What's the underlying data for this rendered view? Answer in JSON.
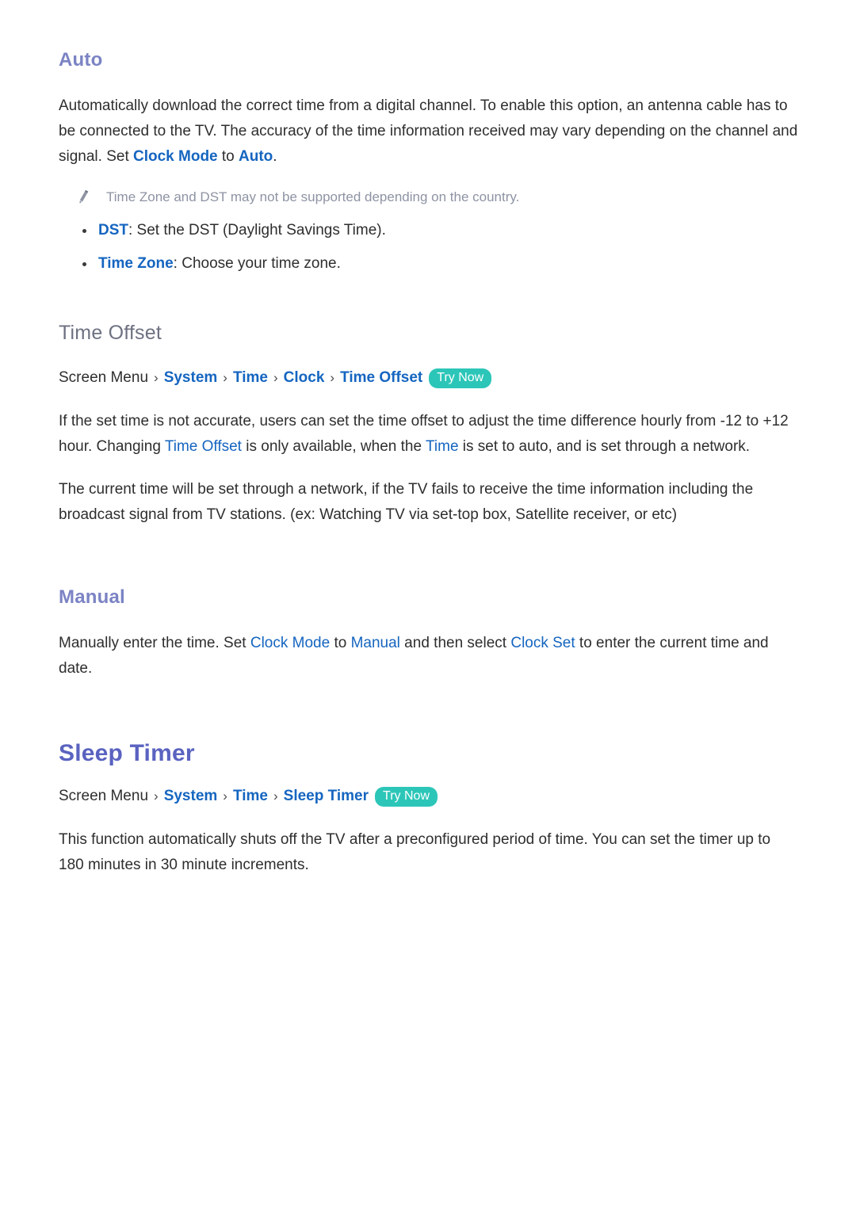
{
  "sections": {
    "auto": {
      "heading": "Auto",
      "paragraph": {
        "part1": "Automatically download the correct time from a digital channel. To enable this option, an antenna cable has to be connected to the TV. The accuracy of the time information received may vary depending on the channel and signal. Set ",
        "link1": "Clock Mode",
        "part2": " to ",
        "link2": "Auto",
        "part3": "."
      },
      "note": {
        "icon": "pencil-icon",
        "text": "Time Zone and DST may not be supported depending on the country."
      },
      "bullets": [
        {
          "term": "DST",
          "rest": ": Set the DST (Daylight Savings Time)."
        },
        {
          "term": "Time Zone",
          "rest": ": Choose your time zone."
        }
      ]
    },
    "time_offset": {
      "heading": "Time Offset",
      "breadcrumb": {
        "root": "Screen Menu",
        "separator": "›",
        "links": [
          "System",
          "Time",
          "Clock",
          "Time Offset"
        ],
        "badge": "Try Now"
      },
      "paragraph1": {
        "part1": "If the set time is not accurate, users can set the time offset to adjust the time difference hourly from -12 to +12 hour. Changing ",
        "link1": "Time Offset",
        "part2": " is only available, when the ",
        "link2": "Time",
        "part3": " is set to auto, and is set through a network."
      },
      "paragraph2": "The current time will be set through a network, if the TV fails to receive the time information including the broadcast signal from TV stations. (ex: Watching TV via set-top box, Satellite receiver, or etc)"
    },
    "manual": {
      "heading": "Manual",
      "paragraph": {
        "part1": "Manually enter the time. Set ",
        "link1": "Clock Mode",
        "part2": " to ",
        "link2": "Manual",
        "part3": " and then select ",
        "link3": "Clock Set",
        "part4": " to enter the current time and date."
      }
    },
    "sleep_timer": {
      "heading": "Sleep Timer",
      "breadcrumb": {
        "root": "Screen Menu",
        "separator": "›",
        "links": [
          "System",
          "Time",
          "Sleep Timer"
        ],
        "badge": "Try Now"
      },
      "paragraph": "This function automatically shuts off the TV after a preconfigured period of time. You can set the timer up to 180 minutes in 30 minute increments."
    }
  },
  "colors": {
    "heading_purple": "#7b83c4",
    "heading_main_purple": "#5a63c0",
    "heading_gray": "#6d7181",
    "link_blue": "#1565c0",
    "badge_teal": "#2cc6b8",
    "note_gray": "#8e93a3",
    "body_text": "#2e2e2e",
    "page_background": "#ffffff"
  }
}
